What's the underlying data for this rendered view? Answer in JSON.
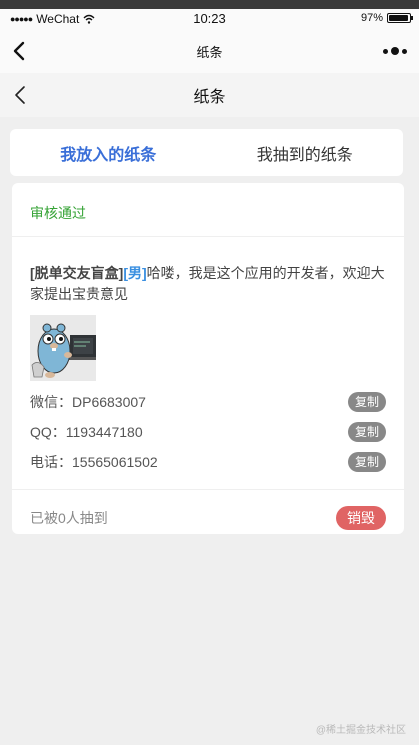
{
  "status_bar": {
    "carrier": "WeChat",
    "time": "10:23",
    "battery_percent": "97%",
    "battery_level": 0.97
  },
  "wechat_nav": {
    "title": "纸条",
    "back_icon": "chevron-left-icon",
    "more_icon": "more-dots-icon"
  },
  "page_nav": {
    "title": "纸条",
    "back_icon": "chevron-left-icon"
  },
  "tabs": [
    {
      "label": "我放入的纸条",
      "active": true
    },
    {
      "label": "我抽到的纸条",
      "active": false
    }
  ],
  "note": {
    "review_status": "审核通过",
    "tag": "[脱单交友盲盒]",
    "gender": "[男]",
    "message": "哈喽，我是这个应用的开发者，欢迎大家提出宝贵意见",
    "image_icon": "gopher-mascot-image",
    "contacts": [
      {
        "label": "微信：DP6683007",
        "copy_label": "复制"
      },
      {
        "label": "QQ：1193447180",
        "copy_label": "复制"
      },
      {
        "label": "电话：15565061502",
        "copy_label": "复制"
      }
    ],
    "drawn_count": "已被0人抽到",
    "destroy_label": "销毁"
  },
  "watermark": "@稀土掘金技术社区",
  "colors": {
    "accent_blue": "#3a6fd8",
    "status_green": "#36a336",
    "destroy_red": "#e06464",
    "copy_gray": "#888888"
  }
}
